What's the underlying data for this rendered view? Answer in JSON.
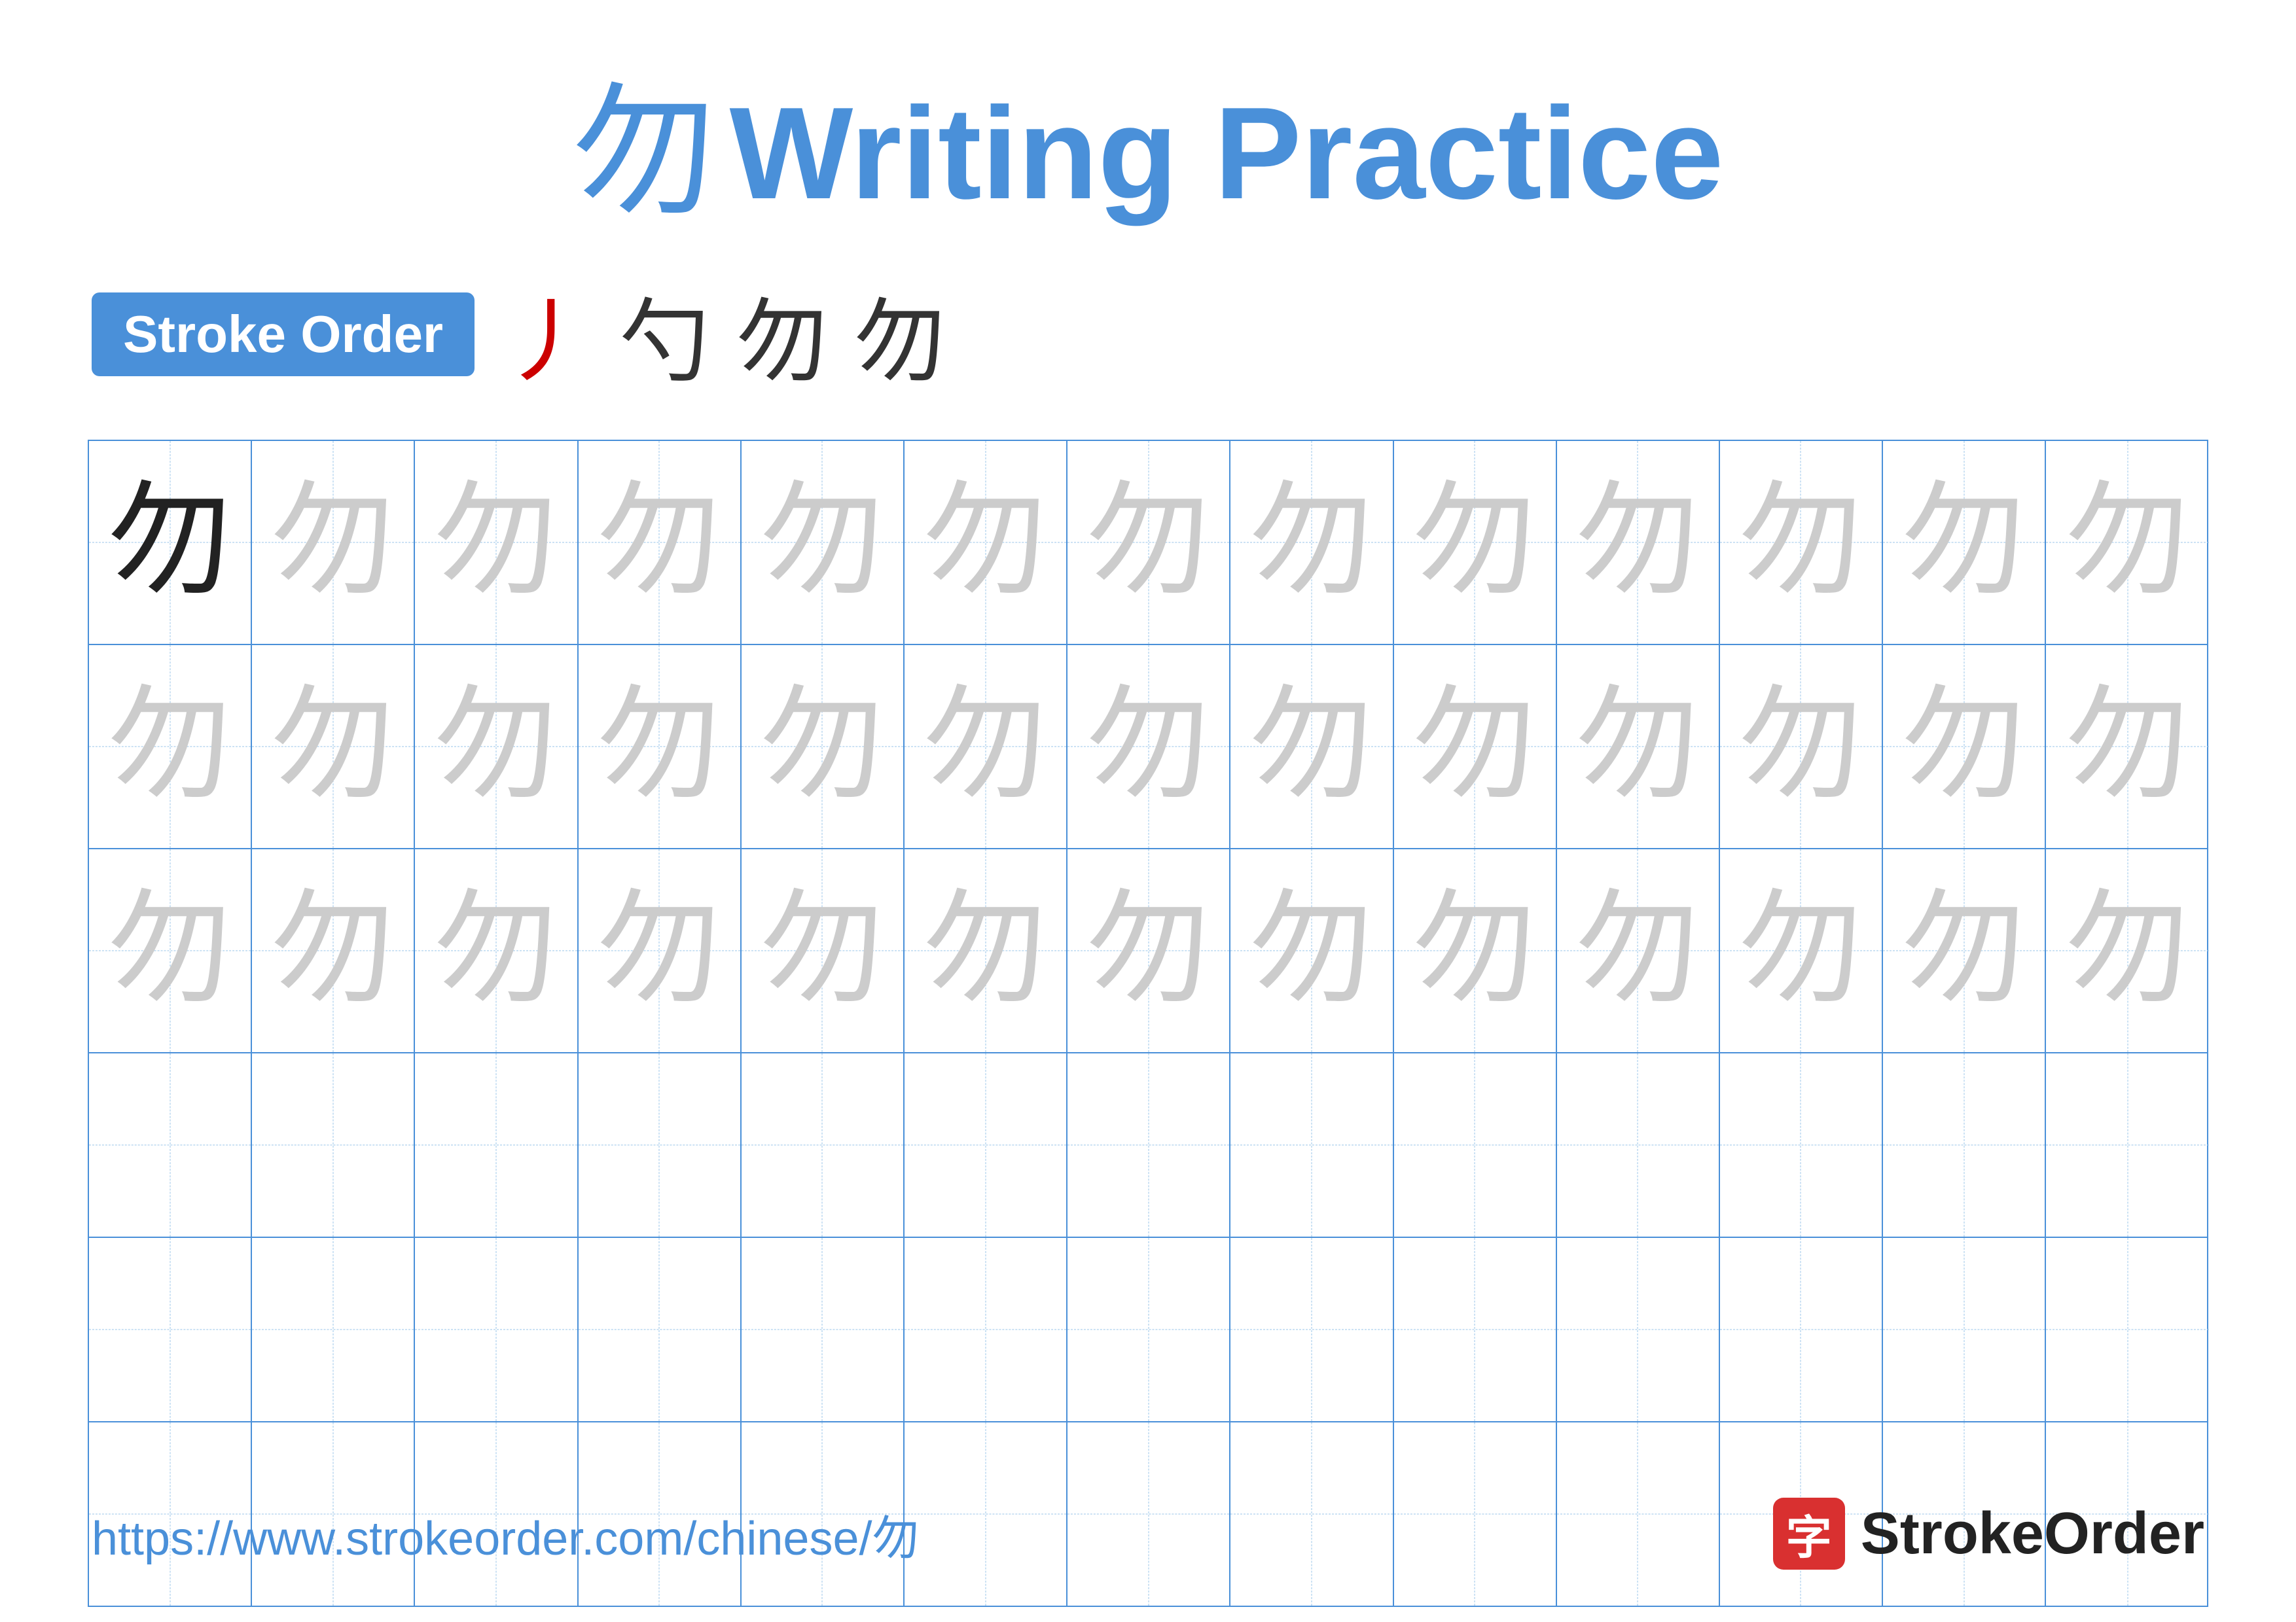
{
  "title": {
    "char": "勿",
    "writing_practice": "Writing Practice"
  },
  "stroke_order": {
    "badge_label": "Stroke Order",
    "steps": [
      "丿",
      "勺",
      "勿",
      "勿"
    ]
  },
  "grid": {
    "cols": 13,
    "rows": 6,
    "char": "勿",
    "row_data": [
      {
        "type": "row1",
        "first_dark": true,
        "rest_light": true,
        "count": 13
      },
      {
        "type": "light",
        "count": 13
      },
      {
        "type": "light",
        "count": 13
      },
      {
        "type": "empty",
        "count": 13
      },
      {
        "type": "empty",
        "count": 13
      },
      {
        "type": "empty",
        "count": 13
      }
    ]
  },
  "footer": {
    "url": "https://www.strokeorder.com/chinese/勿",
    "brand_label": "StrokeOrder",
    "brand_icon_char": "字"
  }
}
